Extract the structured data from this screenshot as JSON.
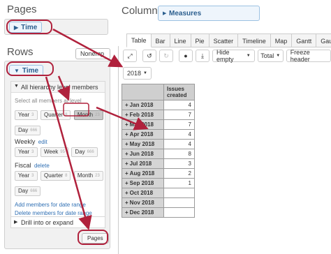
{
  "pages": {
    "title": "Pages",
    "item": "Time"
  },
  "rows": {
    "title": "Rows",
    "nonempty_label": "Nonemp",
    "item": "Time",
    "hierarchy": {
      "header": "All hierarchy level members",
      "select_label": "Select all members at level",
      "default_levels": [
        {
          "label": "Year",
          "count": "3"
        },
        {
          "label": "Quarter",
          "count": "8"
        },
        {
          "label": "Month",
          "count": "23"
        },
        {
          "label": "Day",
          "count": "666"
        }
      ],
      "weekly": {
        "label": "Weekly",
        "edit": "edit",
        "levels": [
          {
            "label": "Year",
            "count": "3"
          },
          {
            "label": "Week",
            "count": "95"
          },
          {
            "label": "Day",
            "count": "666"
          }
        ]
      },
      "fiscal": {
        "label": "Fiscal",
        "delete": "delete",
        "levels": [
          {
            "label": "Year",
            "count": "3"
          },
          {
            "label": "Quarter",
            "count": "8"
          },
          {
            "label": "Month",
            "count": "23"
          },
          {
            "label": "Day",
            "count": "666"
          }
        ]
      },
      "add_link": "Add members for date range",
      "delete_link": "Delete members for date range"
    },
    "drill": "Drill into or expand",
    "pages_button": "Pages"
  },
  "columns": {
    "title": "Columns",
    "item": "Measures"
  },
  "tabs": [
    "Table",
    "Bar",
    "Line",
    "Pie",
    "Scatter",
    "Timeline",
    "Map",
    "Gantt",
    "Gauge"
  ],
  "active_tab": "Table",
  "toolbar": {
    "hide_empty": "Hide empty",
    "total": "Total",
    "freeze_header": "Freeze header",
    "page_filter": "2018"
  },
  "table": {
    "header": "Issues created",
    "rows": [
      {
        "label": "Jan 2018",
        "value": "4"
      },
      {
        "label": "Feb 2018",
        "value": "7"
      },
      {
        "label": "Mar 2018",
        "value": "7"
      },
      {
        "label": "Apr 2018",
        "value": "4"
      },
      {
        "label": "May 2018",
        "value": "4"
      },
      {
        "label": "Jun 2018",
        "value": "8"
      },
      {
        "label": "Jul 2018",
        "value": "3"
      },
      {
        "label": "Aug 2018",
        "value": "2"
      },
      {
        "label": "Sep 2018",
        "value": "1"
      },
      {
        "label": "Oct 2018",
        "value": ""
      },
      {
        "label": "Nov 2018",
        "value": ""
      },
      {
        "label": "Dec 2018",
        "value": ""
      }
    ]
  },
  "colors": {
    "annotation_red": "#b0213c",
    "link_blue": "#2f6fb3",
    "pill_bg": "#eef5fc"
  }
}
